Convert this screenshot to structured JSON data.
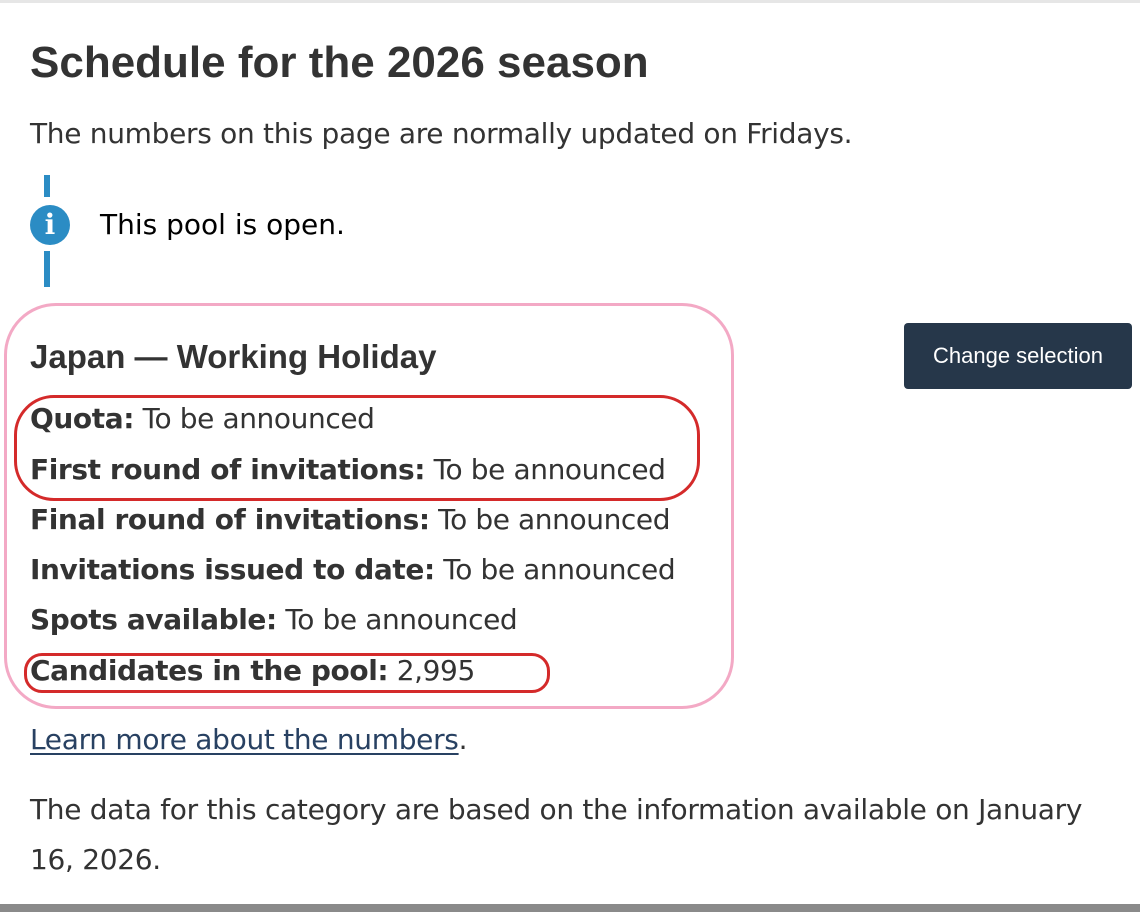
{
  "page": {
    "title": "Schedule for the 2026 season",
    "intro": "The numbers on this page are normally updated on Fridays."
  },
  "alert": {
    "icon": "info-icon",
    "text": "This pool is open.",
    "color": "#2b8cc4"
  },
  "category": {
    "title": "Japan — Working Holiday",
    "change_button": "Change selection",
    "stats": [
      {
        "label": "Quota:",
        "value": "To be announced"
      },
      {
        "label": "First round of invitations:",
        "value": "To be announced"
      },
      {
        "label": "Final round of invitations:",
        "value": "To be announced"
      },
      {
        "label": "Invitations issued to date:",
        "value": "To be announced"
      },
      {
        "label": "Spots available:",
        "value": "To be announced"
      },
      {
        "label": "Candidates in the pool:",
        "value": "2,995"
      }
    ]
  },
  "learn_more": {
    "link_text": "Learn more about the numbers",
    "suffix": "."
  },
  "footer_note": "The data for this category are based on the information available on January 16, 2026.",
  "colors": {
    "button_bg": "#26374a",
    "link": "#284162",
    "annotation_pink": "#f3a9c5",
    "annotation_red": "#d42a2a"
  }
}
